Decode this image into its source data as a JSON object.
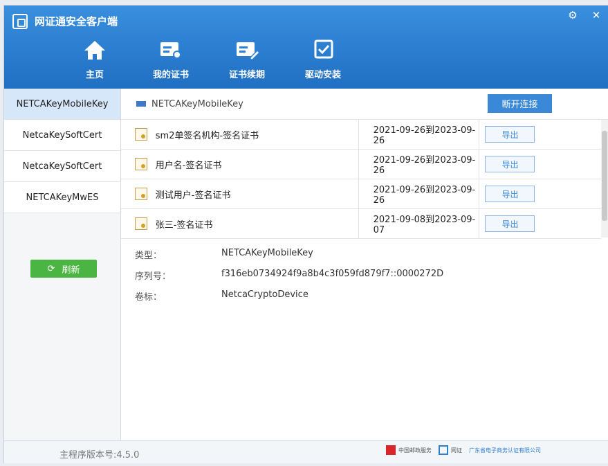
{
  "app": {
    "title": "网证通安全客户端",
    "version_label": "主程序版本号:4.5.0"
  },
  "nav": [
    {
      "label": "主页",
      "icon": "home-icon"
    },
    {
      "label": "我的证书",
      "icon": "cert-user-icon"
    },
    {
      "label": "证书续期",
      "icon": "cert-renew-icon"
    },
    {
      "label": "驱动安装",
      "icon": "checkbox-icon"
    }
  ],
  "sidebar": {
    "items": [
      {
        "label": "NETCAKeyMobileKey",
        "selected": true
      },
      {
        "label": "NetcaKeySoftCert"
      },
      {
        "label": "NetcaKeySoftCert"
      },
      {
        "label": "NETCAKeyMwES"
      }
    ],
    "refresh_label": "刷新"
  },
  "device": {
    "name": "NETCAKeyMobileKey",
    "disconnect_label": "断开连接"
  },
  "certs": [
    {
      "name": "sm2单签名机构-签名证书",
      "period": "2021-09-26到2023-09-26",
      "export_label": "导出"
    },
    {
      "name": "用户名-签名证书",
      "period": "2021-09-26到2023-09-26",
      "export_label": "导出"
    },
    {
      "name": "测试用户-签名证书",
      "period": "2021-09-26到2023-09-26",
      "export_label": "导出"
    },
    {
      "name": "张三-签名证书",
      "period": "2021-09-08到2023-09-07",
      "export_label": "导出"
    }
  ],
  "info": {
    "type_label": "类型：",
    "type_value": "NETCAKeyMobileKey",
    "serial_label": "序列号：",
    "serial_value": "f316eb0734924f9a8b4c3f059fd879f7::0000272D",
    "volume_label": "卷标：",
    "volume_value": "NetcaCryptoDevice"
  },
  "footer_logos": [
    {
      "text": "中国邮政服务"
    },
    {
      "text": "网证"
    },
    {
      "text": "广东省电子商务认证有限公司"
    }
  ],
  "colors": {
    "header_blue": "#2b7fd6",
    "accent_green": "#4bb543",
    "button_blue": "#3a88d8"
  }
}
